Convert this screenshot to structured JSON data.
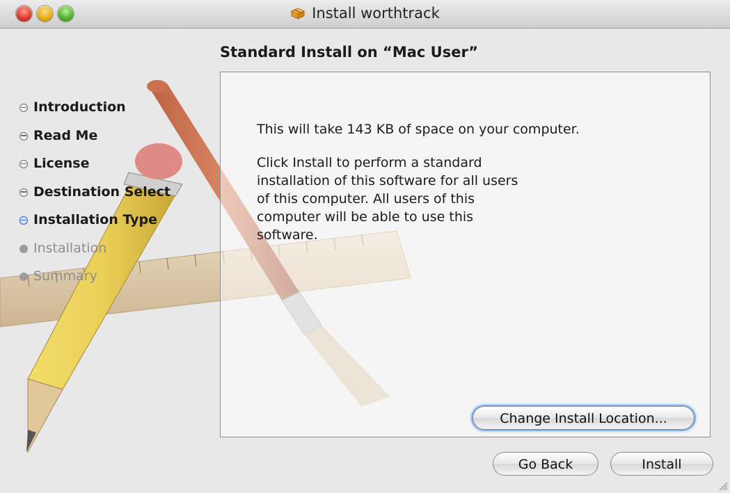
{
  "window": {
    "title": "Install worthtrack",
    "icon": "package-icon"
  },
  "heading": "Standard Install on “Mac User”",
  "steps": [
    {
      "label": "Introduction",
      "state": "completed"
    },
    {
      "label": "Read Me",
      "state": "completed"
    },
    {
      "label": "License",
      "state": "completed"
    },
    {
      "label": "Destination Select",
      "state": "completed"
    },
    {
      "label": "Installation Type",
      "state": "current"
    },
    {
      "label": "Installation",
      "state": "future"
    },
    {
      "label": "Summary",
      "state": "future"
    }
  ],
  "content": {
    "space_text": "This will take 143 KB of space on your computer.",
    "description": "Click Install to perform a standard installation of this software for all users of this computer. All users of this computer will be able to use this software."
  },
  "buttons": {
    "change_location": "Change Install Location...",
    "go_back": "Go Back",
    "install": "Install"
  },
  "colors": {
    "current_step": "#2a5bd7",
    "focus_ring": "#7fb1ec",
    "window_bg": "#e8e8e8"
  }
}
